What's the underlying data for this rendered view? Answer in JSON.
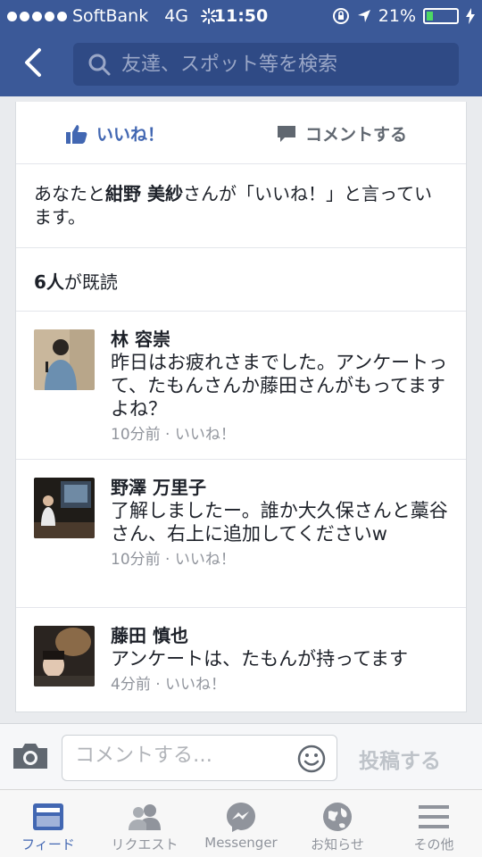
{
  "status": {
    "carrier": "SoftBank",
    "network": "4G",
    "time": "11:50",
    "battery": "21%",
    "battery_fraction": 0.21
  },
  "nav": {
    "search_placeholder": "友達、スポット等を検索"
  },
  "actions": {
    "like_label": "いいね！",
    "comment_label": "コメントする"
  },
  "likes": {
    "prefix": "あなたと",
    "name": "紺野 美紗",
    "suffix": "さんが「いいね！」と言っています。"
  },
  "seen": {
    "count": "6人",
    "label": "が既読"
  },
  "comments": [
    {
      "name": "林 容崇",
      "text": "昨日はお疲れさまでした。アンケートって、たもんさんか藤田さんがもってますよね？",
      "time": "10分前",
      "like": "いいね！"
    },
    {
      "name": "野澤 万里子",
      "text": "了解しましたー。誰か大久保さんと藁谷さん、右上に追加してくださいw",
      "time": "10分前",
      "like": "いいね！"
    },
    {
      "name": "藤田 慎也",
      "text": "アンケートは、たもんが持ってます",
      "time": "4分前",
      "like": "いいね！"
    }
  ],
  "composer": {
    "placeholder": "コメントする…",
    "post_label": "投稿する"
  },
  "tabs": [
    {
      "label": "フィード",
      "icon": "feed-icon"
    },
    {
      "label": "リクエスト",
      "icon": "friend-requests-icon"
    },
    {
      "label": "Messenger",
      "icon": "messenger-icon"
    },
    {
      "label": "お知らせ",
      "icon": "globe-notifications-icon"
    },
    {
      "label": "その他",
      "icon": "menu-icon"
    }
  ],
  "colors": {
    "brand": "#3b5998",
    "accent": "#4267b2",
    "muted": "#90949c"
  }
}
